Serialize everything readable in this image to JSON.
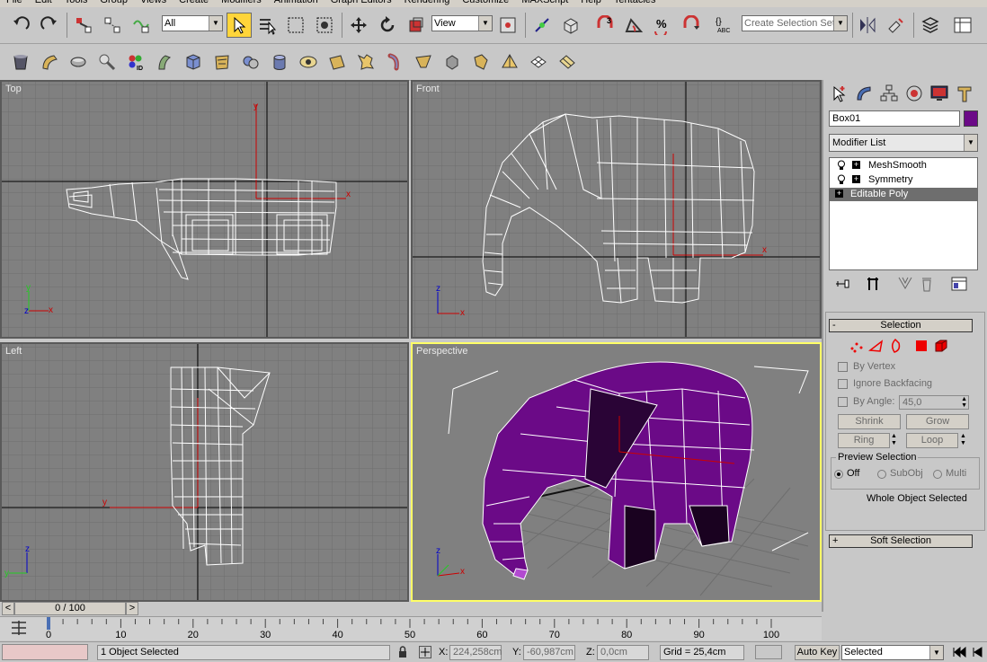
{
  "menu": [
    "File",
    "Edit",
    "Tools",
    "Group",
    "Views",
    "Create",
    "Modifiers",
    "Animation",
    "Graph Editors",
    "Rendering",
    "Customize",
    "MAXScript",
    "Help",
    "Tentacles"
  ],
  "toolbar": {
    "selection_filter": "All",
    "reference_coord": "View",
    "named_selection": "Create Selection Set"
  },
  "viewports": {
    "top": {
      "label": "Top"
    },
    "front": {
      "label": "Front"
    },
    "left": {
      "label": "Left"
    },
    "perspective": {
      "label": "Perspective"
    }
  },
  "axes": {
    "x": "x",
    "y": "y",
    "z": "z"
  },
  "command_panel": {
    "object_name": "Box01",
    "object_color": "#6b0a87",
    "modifier_list": "Modifier List",
    "stack": [
      "MeshSmooth",
      "Symmetry",
      "Editable Poly"
    ],
    "selection_rollout": {
      "title": "Selection",
      "by_vertex": "By Vertex",
      "ignore_backfacing": "Ignore Backfacing",
      "by_angle": "By Angle:",
      "angle_value": "45,0",
      "shrink": "Shrink",
      "grow": "Grow",
      "ring": "Ring",
      "loop": "Loop",
      "preview_title": "Preview Selection",
      "off": "Off",
      "subobj": "SubObj",
      "multi": "Multi",
      "status": "Whole Object Selected"
    },
    "soft_selection": "Soft Selection",
    "collapse_minus": "-",
    "expand_plus": "+"
  },
  "timeline": {
    "frame_display": "0 / 100",
    "prev": "<",
    "next": ">",
    "ticks": [
      "0",
      "10",
      "20",
      "30",
      "40",
      "50",
      "60",
      "70",
      "80",
      "90",
      "100"
    ]
  },
  "statusbar": {
    "selection": "1 Object Selected",
    "x_label": "X:",
    "x_value": "224,258cm",
    "y_label": "Y:",
    "y_value": "-60,987cm",
    "z_label": "Z:",
    "z_value": "0,0cm",
    "grid": "Grid = 25,4cm",
    "autokey": "Auto Key",
    "key_mode": "Selected"
  },
  "colors": {
    "viewport_bg": "#808080",
    "active_border": "#ffff66",
    "mesh_purple": "#6b0a87",
    "highlight": "#ffd53a"
  }
}
